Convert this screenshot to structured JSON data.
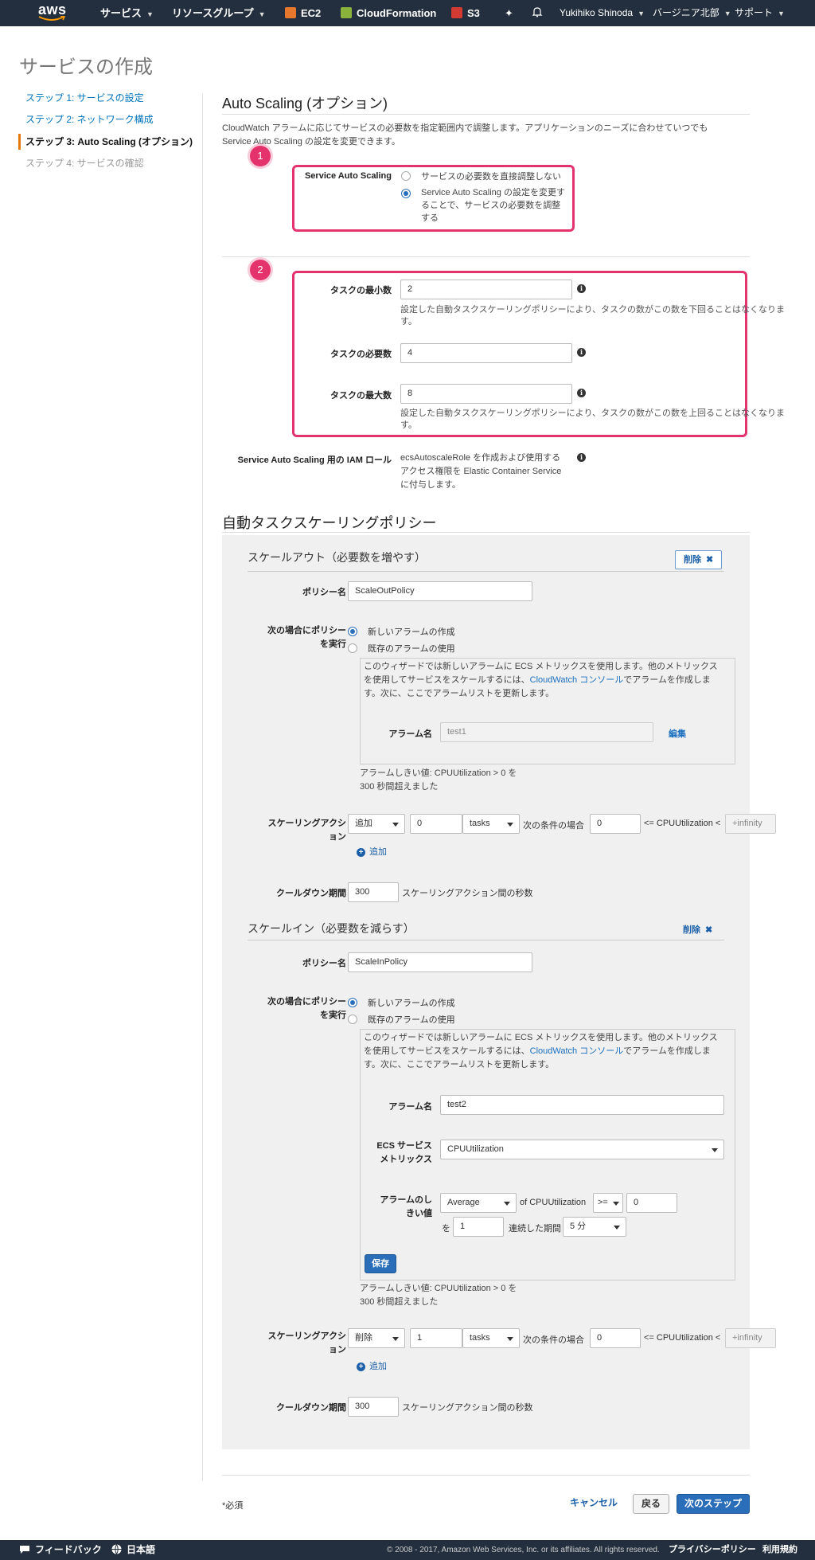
{
  "nav": {
    "logo": "aws",
    "services": "サービス",
    "resource_groups": "リソースグループ",
    "ec2": "EC2",
    "cloudformation": "CloudFormation",
    "s3": "S3",
    "user": "Yukihiko Shinoda",
    "region": "バージニア北部",
    "support": "サポート"
  },
  "page_title": "サービスの作成",
  "steps": [
    "ステップ 1: サービスの設定",
    "ステップ 2: ネットワーク構成",
    "ステップ 3: Auto Scaling (オプション)",
    "ステップ 4: サービスの確認"
  ],
  "auto_scaling": {
    "title": "Auto Scaling (オプション)",
    "description_line1": "CloudWatch アラームに応じてサービスの必要数を指定範囲内で調整します。アプリケーションのニーズに合わせていつでも",
    "description_line2": "Service Auto Scaling の設定を変更できます。",
    "badge1": "1",
    "badge2": "2",
    "service_auto_scaling_label": "Service Auto Scaling",
    "option_no": "サービスの必要数を直接調整しない",
    "option_yes_line1": "Service Auto Scaling の設定を変更す",
    "option_yes_line2": "ることで、サービスの必要数を調整",
    "option_yes_line3": "する",
    "min_tasks_label": "タスクの最小数",
    "min_tasks_value": "2",
    "min_desc_line1": "設定した自動タスクスケーリングポリシーにより、タスクの数がこの数を下回ることはなくなりま",
    "min_desc_line2": "す。",
    "desired_tasks_label": "タスクの必要数",
    "desired_tasks_value": "4",
    "max_tasks_label": "タスクの最大数",
    "max_tasks_value": "8",
    "max_desc_line1": "設定した自動タスクスケーリングポリシーにより、タスクの数がこの数を上回ることはなくなりま",
    "max_desc_line2": "す。",
    "iam_role_label": "Service Auto Scaling 用の IAM ロール",
    "iam_desc_line1": "ecsAutoscaleRole を作成および使用する",
    "iam_desc_line2": "アクセス権限を Elastic Container Service",
    "iam_desc_line3": "に付与します。"
  },
  "policies": {
    "title": "自動タスクスケーリングポリシー",
    "scale_out": {
      "title": "スケールアウト（必要数を増やす）",
      "delete": "削除",
      "policy_name_label": "ポリシー名",
      "policy_name": "ScaleOutPolicy",
      "exec_label_line1": "次の場合にポリシー",
      "exec_label_line2": "を実行",
      "opt_new_alarm": "新しいアラームの作成",
      "opt_existing_alarm": "既存のアラームの使用",
      "wizard_line1": "このウィザードでは新しいアラームに ECS メトリックスを使用します。他のメトリックス",
      "wizard_line2_pre": "を使用してサービスをスケールするには、",
      "wizard_link": "CloudWatch コンソール",
      "wizard_line2_post": "でアラームを作成しま",
      "wizard_line3": "す。次に、ここでアラームリストを更新します。",
      "alarm_name_label": "アラーム名",
      "alarm_name": "test1",
      "edit": "編集",
      "threshold_line1": "アラームしきい値: CPUUtilization > 0 を",
      "threshold_line2": "300 秒間超えました",
      "scaling_action_label_line1": "スケーリングアクシ",
      "scaling_action_label_line2": "ョン",
      "action": "追加",
      "action_value": "0",
      "unit": "tasks",
      "condition": "次の条件の場合",
      "lower_bound": "0",
      "metric_compare": "<= CPUUtilization <",
      "upper_bound": "+infinity",
      "add": "追加",
      "cooldown_label": "クールダウン期間",
      "cooldown": "300",
      "cooldown_unit": "スケーリングアクション間の秒数"
    },
    "scale_in": {
      "title": "スケールイン（必要数を減らす）",
      "delete": "削除",
      "policy_name_label": "ポリシー名",
      "policy_name": "ScaleInPolicy",
      "exec_label_line1": "次の場合にポリシー",
      "exec_label_line2": "を実行",
      "opt_new_alarm": "新しいアラームの作成",
      "opt_existing_alarm": "既存のアラームの使用",
      "wizard_line1": "このウィザードでは新しいアラームに ECS メトリックスを使用します。他のメトリックス",
      "wizard_line2_pre": "を使用してサービスをスケールするには、",
      "wizard_link": "CloudWatch コンソール",
      "wizard_line2_post": "でアラームを作成しま",
      "wizard_line3": "す。次に、ここでアラームリストを更新します。",
      "alarm_name_label": "アラーム名",
      "alarm_name": "test2",
      "metric_label_line1": "ECS サービス",
      "metric_label_line2": "メトリックス",
      "metric": "CPUUtilization",
      "threshold_label_line1": "アラームのし",
      "threshold_label_line2": "きい値",
      "statistic": "Average",
      "of_metric": "of CPUUtilization",
      "operator": ">=",
      "threshold_value": "0",
      "for_prefix": "を",
      "periods": "1",
      "consecutive": "連続した期間",
      "period": "5 分",
      "save": "保存",
      "threshold_line1": "アラームしきい値: CPUUtilization > 0 を",
      "threshold_line2": "300 秒間超えました",
      "scaling_action_label_line1": "スケーリングアクシ",
      "scaling_action_label_line2": "ョン",
      "action": "削除",
      "action_value": "1",
      "unit": "tasks",
      "condition": "次の条件の場合",
      "lower_bound": "0",
      "metric_compare": "<= CPUUtilization <",
      "upper_bound": "+infinity",
      "add": "追加",
      "cooldown_label": "クールダウン期間",
      "cooldown": "300",
      "cooldown_unit": "スケーリングアクション間の秒数"
    }
  },
  "footer": {
    "required": "*必須",
    "cancel": "キャンセル",
    "back": "戻る",
    "next": "次のステップ"
  },
  "bottom_bar": {
    "feedback": "フィードバック",
    "language": "日本語",
    "copyright": "© 2008 - 2017, Amazon Web Services, Inc. or its affiliates. All rights reserved.",
    "privacy": "プライバシーポリシー",
    "terms": "利用規約"
  },
  "colors": {
    "nav_bg": "#232f3e",
    "callout": "#e4326d",
    "primary_button": "#2a6eb9",
    "active_step_marker": "#e47911",
    "ec2_icon": "#e8772e",
    "cloudformation_icon": "#8ab33c",
    "s3_icon": "#d33a34"
  }
}
